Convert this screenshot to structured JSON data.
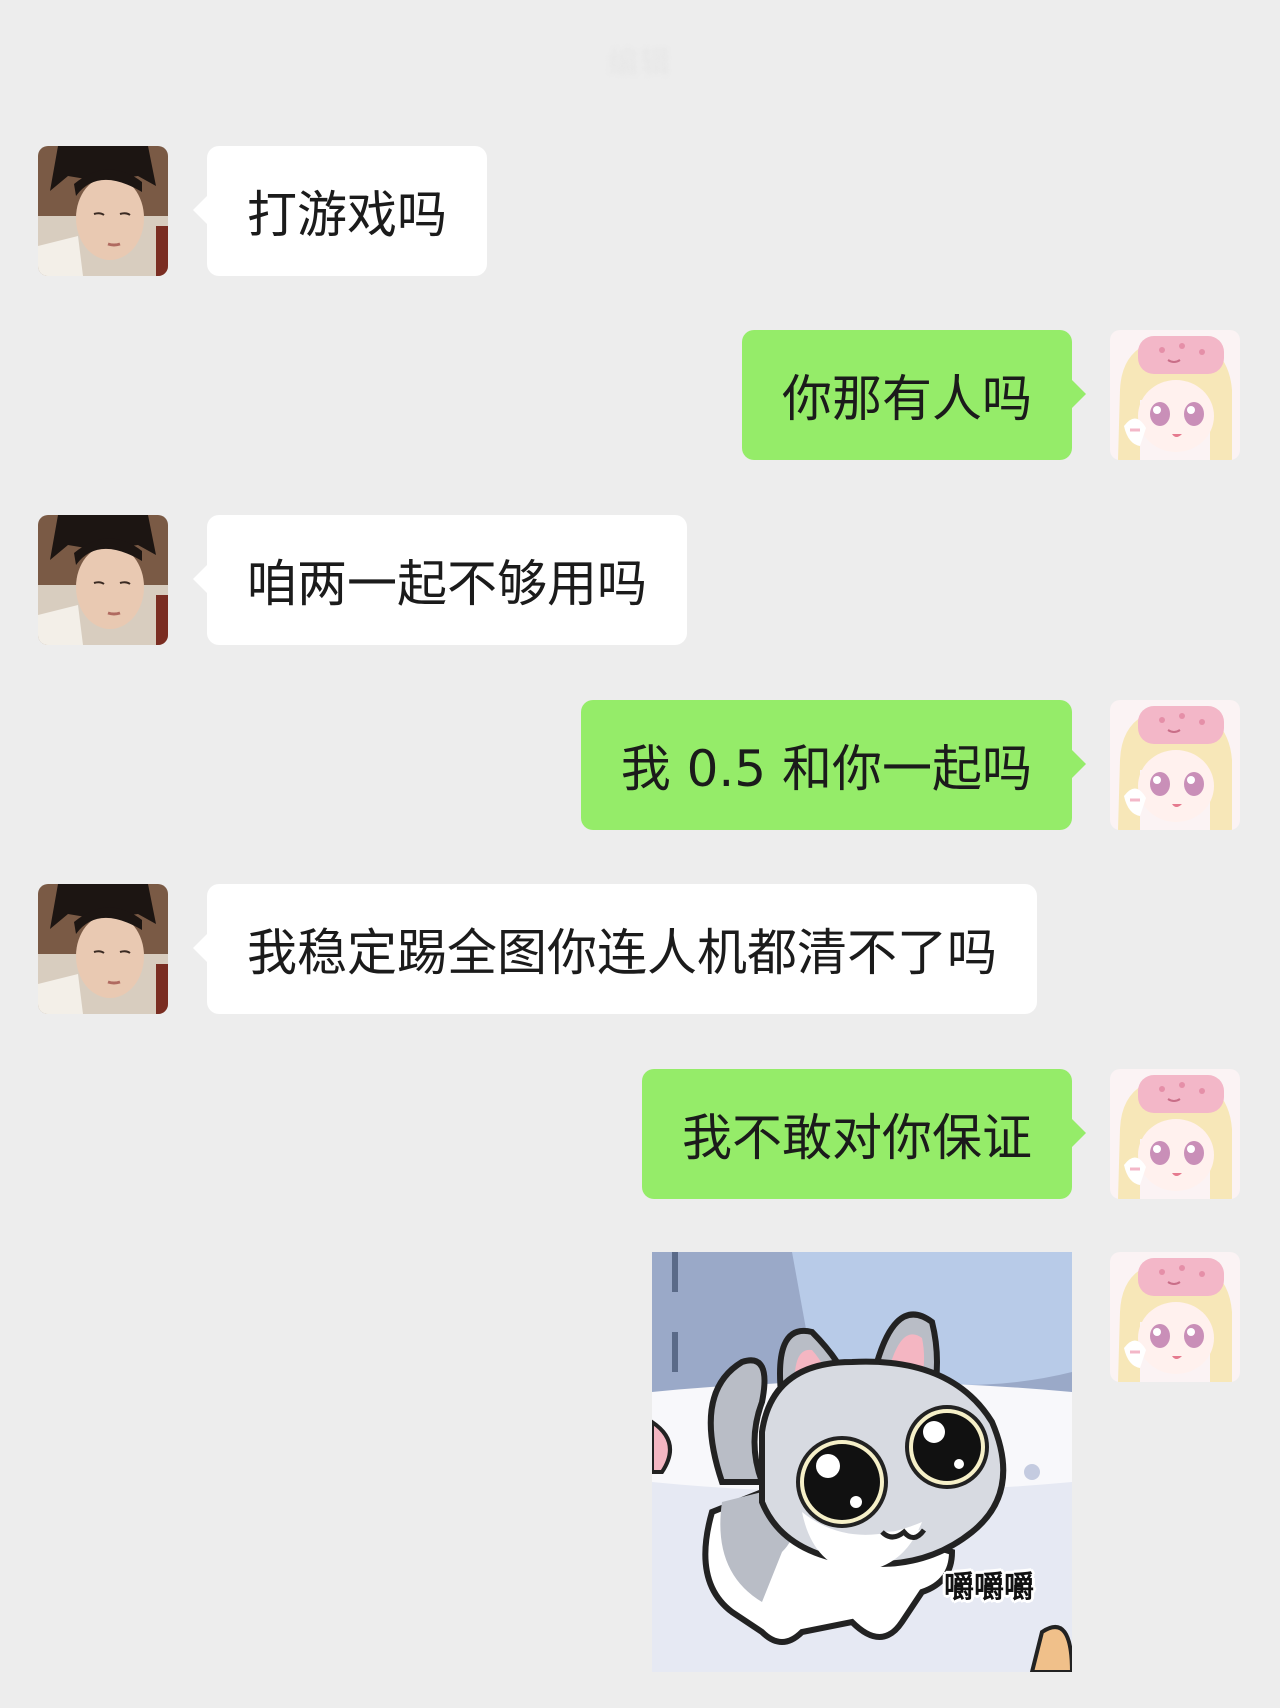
{
  "header": {
    "title": "编辑"
  },
  "messages": [
    {
      "side": "in",
      "text": "打游戏吗"
    },
    {
      "side": "out",
      "text": "你那有人吗"
    },
    {
      "side": "in",
      "text": "咱两一起不够用吗"
    },
    {
      "side": "out",
      "text": "我 0.5 和你一起吗"
    },
    {
      "side": "in",
      "text": "我稳定踢全图你连人机都清不了吗"
    },
    {
      "side": "out",
      "text": "我不敢对你保证"
    }
  ],
  "sticker": {
    "caption": "嚼嚼嚼"
  },
  "avatars": {
    "contact": "contact-avatar",
    "self": "self-avatar"
  },
  "colors": {
    "background": "#ededed",
    "incoming_bubble": "#ffffff",
    "outgoing_bubble": "#95ec69"
  }
}
